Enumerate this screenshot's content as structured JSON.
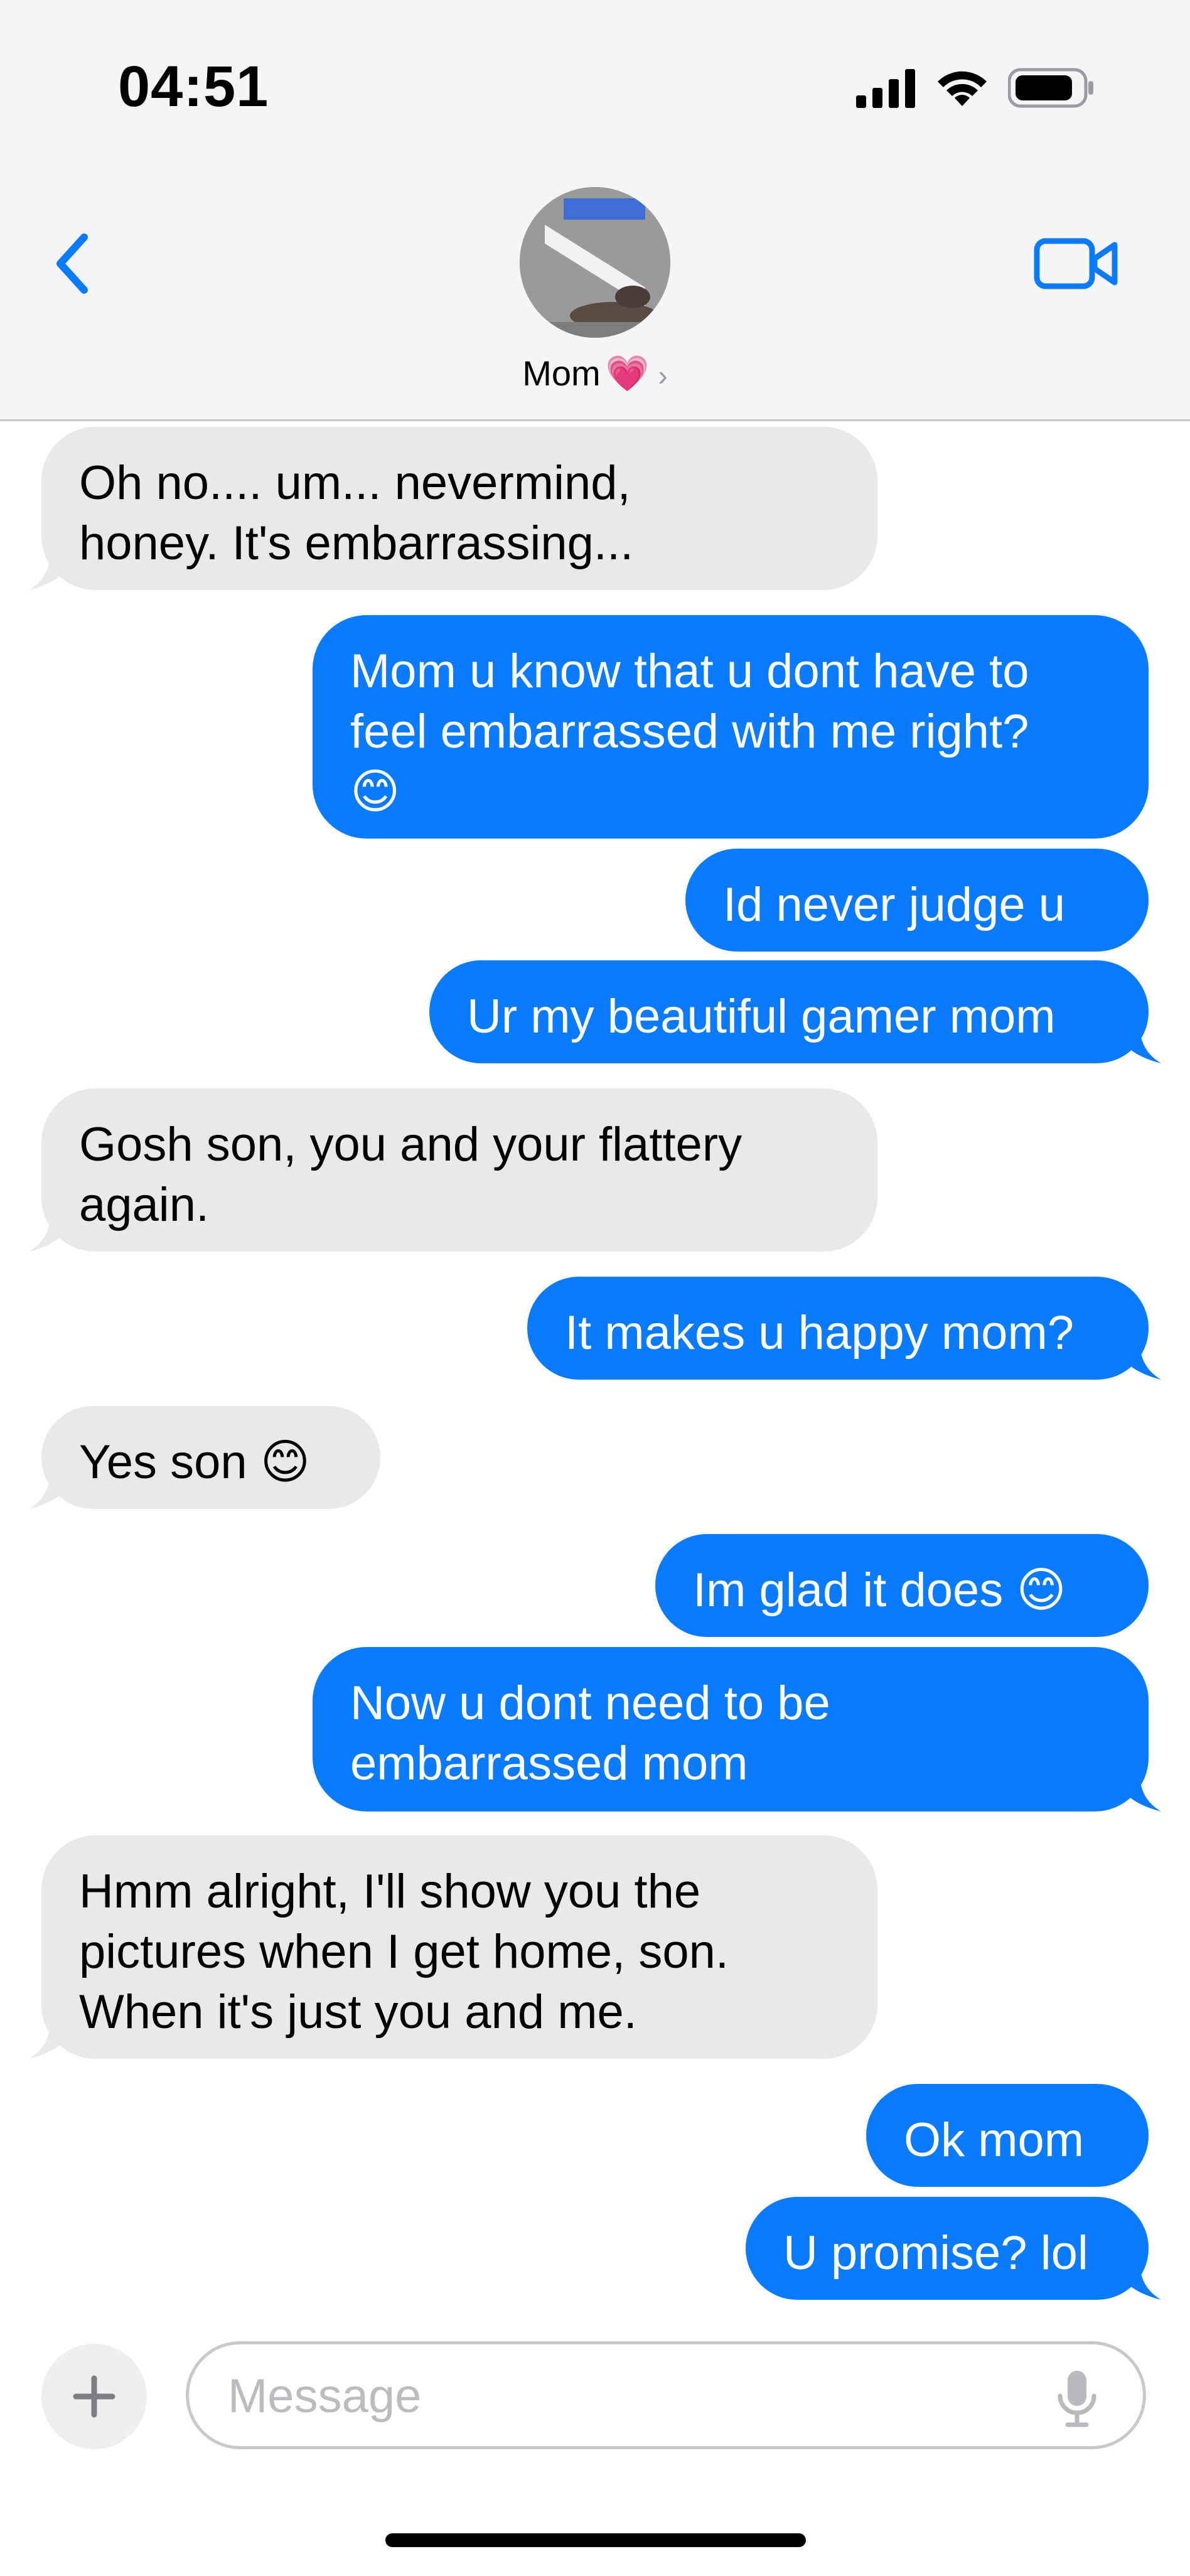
{
  "status_bar": {
    "time": "04:51",
    "icons": [
      "signal-icon",
      "wifi-icon",
      "battery-icon"
    ]
  },
  "header": {
    "contact_name": "Mom",
    "heart": "💗",
    "chevron": "›",
    "icons": [
      "back-chevron-icon",
      "video-call-icon"
    ]
  },
  "colors": {
    "accent": "#0a7aff",
    "incoming_bubble": "#e9e9eb",
    "header_bg": "#f5f5f7"
  },
  "messages": [
    {
      "direction": "incoming",
      "text": "Oh no.... um... nevermind,\nhoney. It's embarrassing..."
    },
    {
      "direction": "outgoing",
      "text": "Mom u know that u dont have to\nfeel embarrassed with me right?\n😊"
    },
    {
      "direction": "outgoing",
      "text": "Id never judge u"
    },
    {
      "direction": "outgoing",
      "text": "Ur my beautiful gamer mom"
    },
    {
      "direction": "incoming",
      "text": "Gosh son, you and your flattery\nagain."
    },
    {
      "direction": "outgoing",
      "text": "It makes u happy mom?"
    },
    {
      "direction": "incoming",
      "text": "Yes son 😊"
    },
    {
      "direction": "outgoing",
      "text": "Im glad it does 😊"
    },
    {
      "direction": "outgoing",
      "text": "Now u dont need to be\nembarrassed mom"
    },
    {
      "direction": "incoming",
      "text": "Hmm alright, I'll show you the\npictures when I get home, son.\nWhen it's just you and me."
    },
    {
      "direction": "outgoing",
      "text": "Ok mom"
    },
    {
      "direction": "outgoing",
      "text": "U promise? lol"
    }
  ],
  "composer": {
    "plus_label": "+",
    "placeholder": "Message"
  }
}
